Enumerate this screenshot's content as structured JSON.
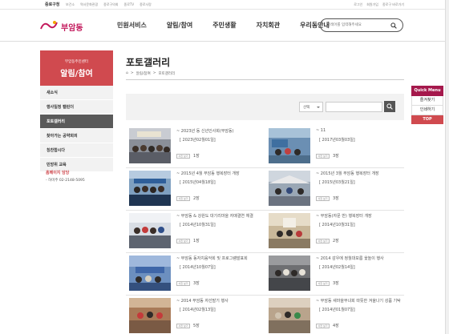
{
  "topbar": {
    "home": "중로구청",
    "links": [
      "보건소",
      "역사문화관광",
      "종로구의회",
      "종로TV",
      "종로사랑"
    ],
    "login": "로그인",
    "join": "회원가입",
    "shortcut": "종로구 바로가기"
  },
  "header": {
    "logo": "부암동",
    "nav": [
      "민원서비스",
      "알림/참여",
      "주민생활",
      "자치회관",
      "우리동안내"
    ],
    "search_placeholder": "검색어를 입력해주세요"
  },
  "sidebar": {
    "subtitle": "부암동주민센터",
    "title": "알림/참여",
    "items": [
      {
        "label": "새소식"
      },
      {
        "label": "행사일정 캘린더"
      },
      {
        "label": "포토갤러리"
      },
      {
        "label": "찾아가는 공약회의"
      },
      {
        "label": "칭찬합시다"
      },
      {
        "label": "민방위 교육"
      }
    ],
    "contact_title": "홈페이지 담당",
    "contact_phone": "- 하미주 02-2148-5095"
  },
  "page": {
    "title": "포토갤러리",
    "breadcrumb": [
      "⌂",
      ">",
      "알림/참여",
      ">",
      "포토갤러리"
    ]
  },
  "searchbar": {
    "select_value": "선택"
  },
  "gallery": [
    {
      "title": "~ 2023년 동 신년인사회(부암동)",
      "date": "[ 2023년02월01일]",
      "badge": "사진 보기",
      "count": "1장"
    },
    {
      "title": "~ 11",
      "date": "[ 2017년03월03일]",
      "badge": "사진 보기",
      "count": "3장"
    },
    {
      "title": "~ 2015년 4월 부암동 행복장터 개장",
      "date": "[ 2015년04월18일]",
      "badge": "사진 보기",
      "count": "2장"
    },
    {
      "title": "~ 2015년 3월 부암동 행복장터 개장",
      "date": "[ 2015년03월21일]",
      "badge": "사진 보기",
      "count": "3장"
    },
    {
      "title": "~ 부암동 & 강원도 대기리마을 자매결연 체결",
      "date": "[ 2014년10월31일]",
      "badge": "사진 보기",
      "count": "1장"
    },
    {
      "title": "~ 부암동(자문 반) 행복장터 개장",
      "date": "[ 2014년10월31일]",
      "badge": "사진 보기",
      "count": "2장"
    },
    {
      "title": "~ 부암동 동자치음악회 및 프로그램발표회",
      "date": "[ 2014년10월07일]",
      "badge": "사진 보기",
      "count": "3장"
    },
    {
      "title": "~ 2014 감우에 정월대보름 윷놀이 행사",
      "date": "[ 2014년02월14일]",
      "badge": "사진 보기",
      "count": "3장"
    },
    {
      "title": "~ 2014 부암동 자선발기 행사",
      "date": "[ 2014년02월13일]",
      "badge": "사진 보기",
      "count": "5장"
    },
    {
      "title": "~ 부암동 새마을부녀회 따뜻한 겨울나기 성품 기탁",
      "date": "[ 2014년01월07일]",
      "badge": "사진 보기",
      "count": "4장"
    }
  ],
  "quickmenu": {
    "title": "Quick Menu",
    "items": [
      "즐겨찾기",
      "인쇄하기"
    ],
    "top": "TOP"
  }
}
